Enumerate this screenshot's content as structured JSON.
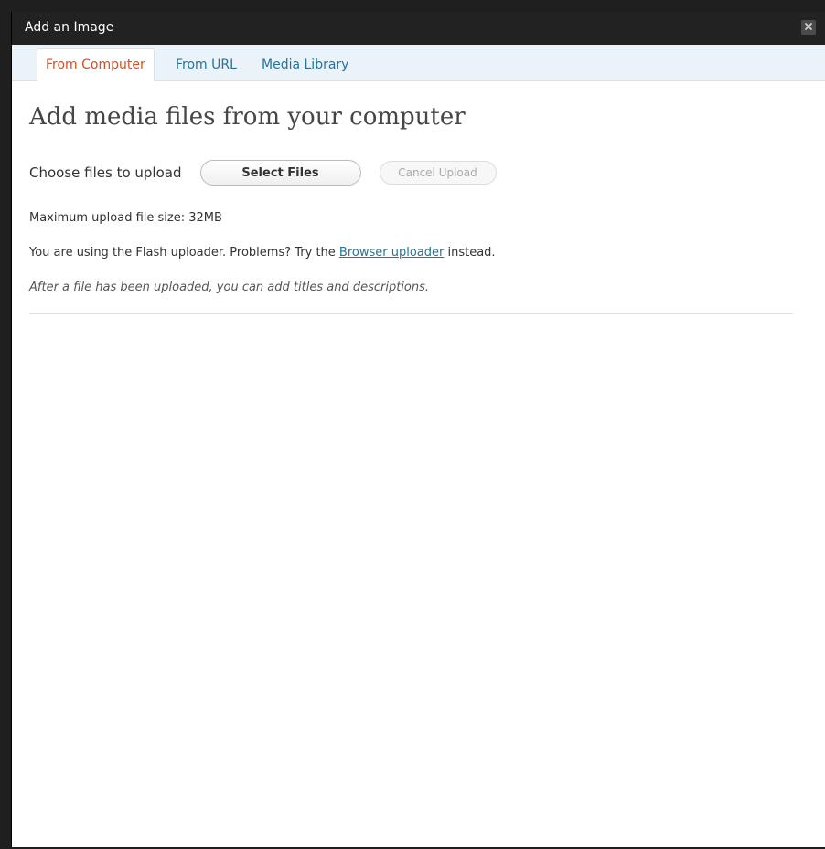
{
  "dialog": {
    "title": "Add an Image",
    "close_icon": "close-icon"
  },
  "tabs": [
    {
      "label": "From Computer",
      "active": true
    },
    {
      "label": "From URL",
      "active": false
    },
    {
      "label": "Media Library",
      "active": false
    }
  ],
  "main": {
    "heading": "Add media files from your computer",
    "choose_label": "Choose files to upload",
    "select_button": "Select Files",
    "cancel_button": "Cancel Upload",
    "max_size": "Maximum upload file size: 32MB",
    "flash_prefix": "You are using the Flash uploader. Problems? Try the ",
    "flash_link": "Browser uploader",
    "flash_suffix": " instead.",
    "after_upload_note": "After a file has been uploaded, you can add titles and descriptions."
  },
  "colors": {
    "active_tab": "#d54e21",
    "link": "#21759b",
    "titlebar": "#222222",
    "tabs_bg": "#eaf2fa"
  }
}
